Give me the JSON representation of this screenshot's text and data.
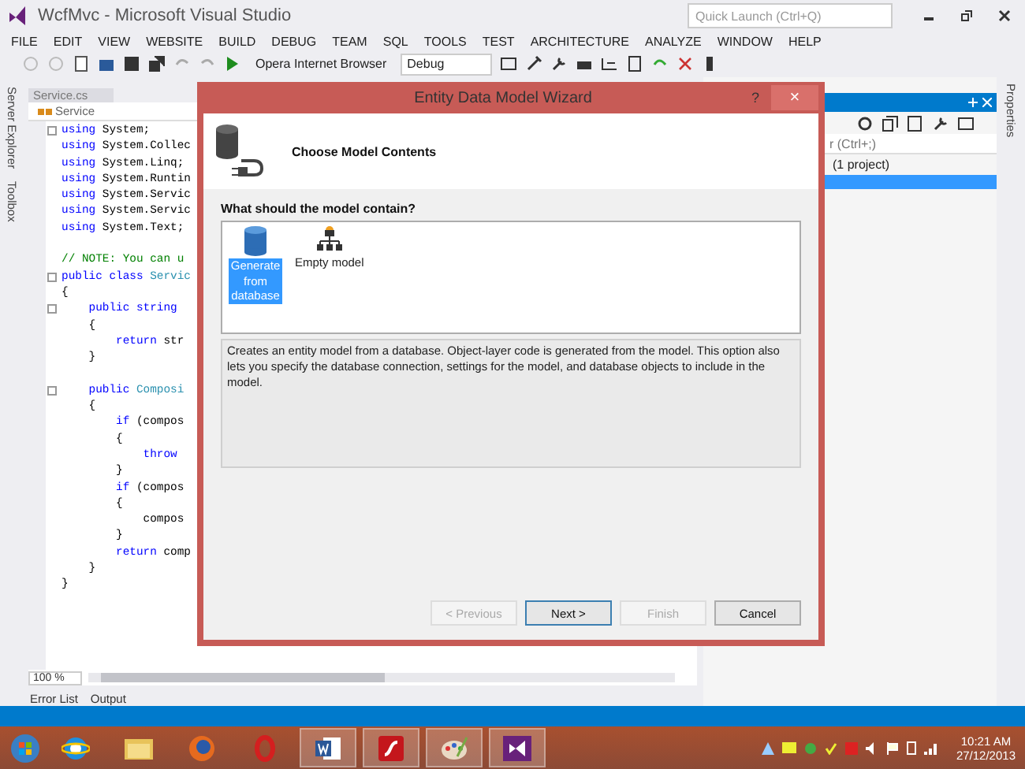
{
  "window": {
    "title": "WcfMvc - Microsoft Visual Studio",
    "quick_launch": {
      "placeholder": "Quick Launch (Ctrl+Q)"
    }
  },
  "menu": [
    "FILE",
    "EDIT",
    "VIEW",
    "WEBSITE",
    "BUILD",
    "DEBUG",
    "TEAM",
    "SQL",
    "TOOLS",
    "TEST",
    "ARCHITECTURE",
    "ANALYZE",
    "WINDOW",
    "HELP"
  ],
  "toolbar": {
    "browser": "Opera Internet Browser",
    "configuration": "Debug"
  },
  "side_tabs": [
    "Server Explorer",
    "Toolbox"
  ],
  "editor": {
    "tab": "Service.cs",
    "navigation": "Service",
    "zoom": "100 %",
    "lines": [
      {
        "kind": "code",
        "fold": true,
        "segments": [
          {
            "t": "using",
            "kind": "keyword"
          },
          {
            "t": " System;",
            "kind": "plain"
          }
        ]
      },
      {
        "kind": "code",
        "fold": false,
        "segments": [
          {
            "t": "using",
            "kind": "keyword"
          },
          {
            "t": " System.Collec",
            "kind": "plain"
          }
        ]
      },
      {
        "kind": "code",
        "fold": false,
        "segments": [
          {
            "t": "using",
            "kind": "keyword"
          },
          {
            "t": " System.Linq;",
            "kind": "plain"
          }
        ]
      },
      {
        "kind": "code",
        "fold": false,
        "segments": [
          {
            "t": "using",
            "kind": "keyword"
          },
          {
            "t": " System.Runtin",
            "kind": "plain"
          }
        ]
      },
      {
        "kind": "code",
        "fold": false,
        "segments": [
          {
            "t": "using",
            "kind": "keyword"
          },
          {
            "t": " System.Servic",
            "kind": "plain"
          }
        ]
      },
      {
        "kind": "code",
        "fold": false,
        "segments": [
          {
            "t": "using",
            "kind": "keyword"
          },
          {
            "t": " System.Servic",
            "kind": "plain"
          }
        ]
      },
      {
        "kind": "code",
        "fold": false,
        "segments": [
          {
            "t": "using",
            "kind": "keyword"
          },
          {
            "t": " System.Text;",
            "kind": "plain"
          }
        ]
      },
      {
        "kind": "blank"
      },
      {
        "kind": "code",
        "fold": false,
        "segments": [
          {
            "t": "// NOTE: You can u",
            "kind": "comment"
          }
        ]
      },
      {
        "kind": "code",
        "fold": true,
        "segments": [
          {
            "t": "public class",
            "kind": "keyword"
          },
          {
            "t": " Servic",
            "kind": "type"
          }
        ]
      },
      {
        "kind": "code",
        "fold": false,
        "segments": [
          {
            "t": "{",
            "kind": "plain"
          }
        ]
      },
      {
        "kind": "code",
        "fold": true,
        "segments": [
          {
            "t": "    public string",
            "kind": "keyword"
          }
        ]
      },
      {
        "kind": "code",
        "fold": false,
        "segments": [
          {
            "t": "    {",
            "kind": "plain"
          }
        ]
      },
      {
        "kind": "code",
        "fold": false,
        "segments": [
          {
            "t": "        return",
            "kind": "keyword"
          },
          {
            "t": " str",
            "kind": "plain"
          }
        ]
      },
      {
        "kind": "code",
        "fold": false,
        "segments": [
          {
            "t": "    }",
            "kind": "plain"
          }
        ]
      },
      {
        "kind": "blank"
      },
      {
        "kind": "code",
        "fold": true,
        "segments": [
          {
            "t": "    public",
            "kind": "keyword"
          },
          {
            "t": " Composi",
            "kind": "type"
          }
        ]
      },
      {
        "kind": "code",
        "fold": false,
        "segments": [
          {
            "t": "    {",
            "kind": "plain"
          }
        ]
      },
      {
        "kind": "code",
        "fold": false,
        "segments": [
          {
            "t": "        if",
            "kind": "keyword"
          },
          {
            "t": " (compos",
            "kind": "plain"
          }
        ]
      },
      {
        "kind": "code",
        "fold": false,
        "segments": [
          {
            "t": "        {",
            "kind": "plain"
          }
        ]
      },
      {
        "kind": "code",
        "fold": false,
        "segments": [
          {
            "t": "            throw",
            "kind": "keyword"
          }
        ]
      },
      {
        "kind": "code",
        "fold": false,
        "segments": [
          {
            "t": "        }",
            "kind": "plain"
          }
        ]
      },
      {
        "kind": "code",
        "fold": false,
        "segments": [
          {
            "t": "        if",
            "kind": "keyword"
          },
          {
            "t": " (compos",
            "kind": "plain"
          }
        ]
      },
      {
        "kind": "code",
        "fold": false,
        "segments": [
          {
            "t": "        {",
            "kind": "plain"
          }
        ]
      },
      {
        "kind": "code",
        "fold": false,
        "segments": [
          {
            "t": "            compos",
            "kind": "plain"
          }
        ]
      },
      {
        "kind": "code",
        "fold": false,
        "segments": [
          {
            "t": "        }",
            "kind": "plain"
          }
        ]
      },
      {
        "kind": "code",
        "fold": false,
        "segments": [
          {
            "t": "        return",
            "kind": "keyword"
          },
          {
            "t": " comp",
            "kind": "plain"
          }
        ]
      },
      {
        "kind": "code",
        "fold": false,
        "segments": [
          {
            "t": "    }",
            "kind": "plain"
          }
        ]
      },
      {
        "kind": "code",
        "fold": false,
        "segments": [
          {
            "t": "}",
            "kind": "plain"
          }
        ]
      }
    ]
  },
  "bottom_tabs": [
    "Error List",
    "Output"
  ],
  "solution_explorer": {
    "search": {
      "placeholder": "r (Ctrl+;)"
    },
    "rows": [
      {
        "label": "(1 project)",
        "selected": false
      },
      {
        "selected": true
      }
    ]
  },
  "right_tabs": [
    "Properties"
  ],
  "dialog": {
    "title": "Entity Data Model Wizard",
    "help": "?",
    "close": "×",
    "heading": "Choose Model Contents",
    "prompt": "What should the model contain?",
    "options": [
      {
        "kind": "database",
        "label": "Generate from database",
        "selected": true
      },
      {
        "kind": "empty_model",
        "label": "Empty model",
        "selected": false
      }
    ],
    "description": "Creates an entity model from a database. Object-layer code is generated from the model. This option also lets you specify the database connection, settings for the model, and database objects to include in the model.",
    "buttons": [
      {
        "label": "< Previous",
        "disabled": true,
        "default": false
      },
      {
        "label": "Next >",
        "disabled": false,
        "default": true
      },
      {
        "label": "Finish",
        "disabled": true,
        "default": false
      },
      {
        "label": "Cancel",
        "disabled": false,
        "default": false
      }
    ]
  },
  "taskbar": {
    "apps": [
      {
        "kind": "ie",
        "active": false
      },
      {
        "kind": "folder",
        "active": false
      },
      {
        "kind": "firefox",
        "active": false
      },
      {
        "kind": "opera",
        "active": false
      },
      {
        "kind": "word",
        "active": true
      },
      {
        "kind": "flash",
        "active": true
      },
      {
        "kind": "paint",
        "active": true
      },
      {
        "kind": "vs",
        "active": true
      }
    ],
    "time": "10:21 AM",
    "date": "27/12/2013"
  }
}
